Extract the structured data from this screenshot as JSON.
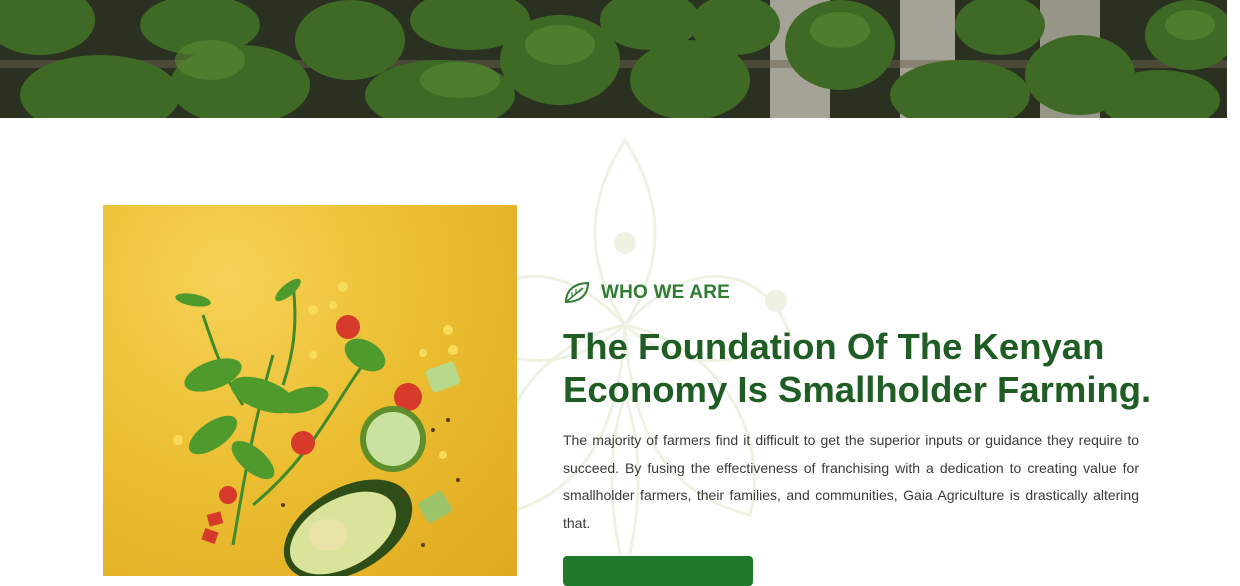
{
  "hero": {
    "image": "avocados-on-conveyor"
  },
  "about": {
    "image": "floating-salad-ingredients",
    "eyebrow_icon": "leaf-icon",
    "eyebrow": "WHO WE ARE",
    "title": "The Foundation Of The Kenyan Economy Is Smallholder Farming.",
    "body": "The majority of farmers find it difficult to get the superior inputs or guidance they require to succeed. By fusing the effectiveness of franchising with a dedication to creating value for smallholder farmers, their families, and communities, Gaia Agriculture is drastically altering that.",
    "cta_label": ""
  },
  "colors": {
    "brand_green": "#1f5d24",
    "accent_green": "#2e7d32",
    "button_green": "#1f7a2c",
    "photo_yellow": "#ecbf33"
  }
}
